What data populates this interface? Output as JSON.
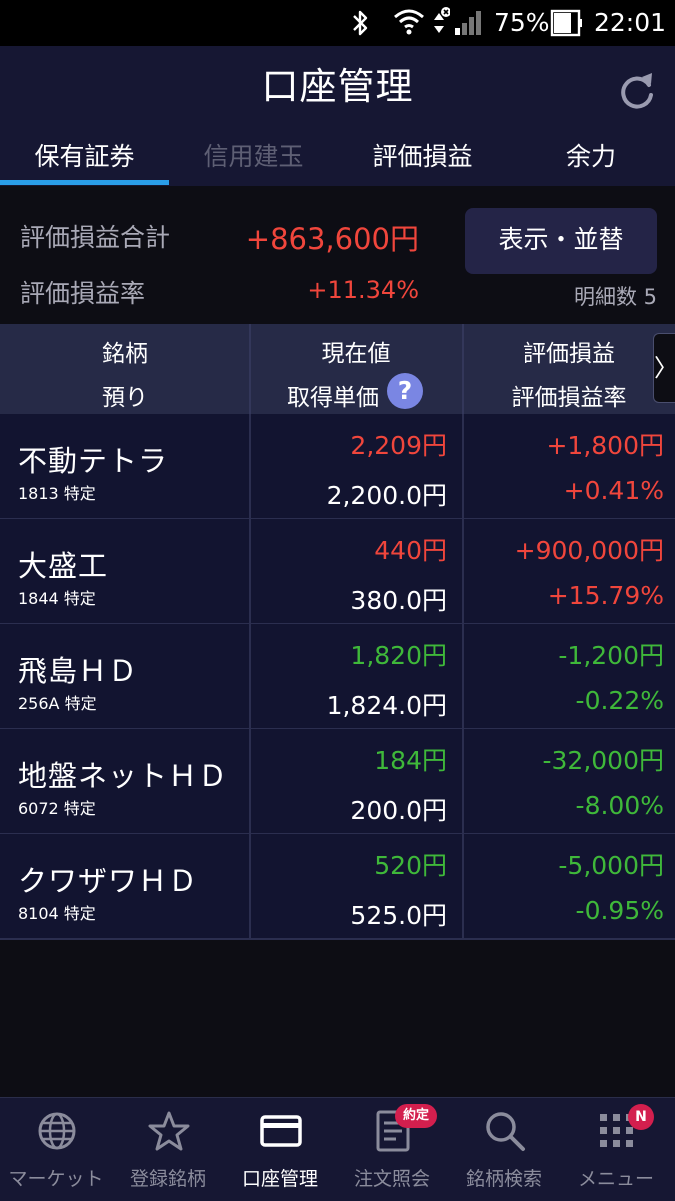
{
  "status_bar": {
    "battery": "75%",
    "time": "22:01"
  },
  "header": {
    "title": "口座管理"
  },
  "tabs": [
    {
      "label": "保有証券",
      "active": true,
      "enabled": true
    },
    {
      "label": "信用建玉",
      "active": false,
      "enabled": false
    },
    {
      "label": "評価損益",
      "active": false,
      "enabled": true
    },
    {
      "label": "余力",
      "active": false,
      "enabled": true
    }
  ],
  "summary": {
    "total_label": "評価損益合計",
    "total_value": "+863,600円",
    "rate_label": "評価損益率",
    "rate_value": "+11.34%",
    "sort_button": "表示・並替",
    "count_label": "明細数 5"
  },
  "table_header": {
    "col1_top": "銘柄",
    "col1_bottom": "預り",
    "col2_top": "現在値",
    "col2_bottom": "取得単価",
    "help": "?",
    "col3_top": "評価損益",
    "col3_bottom": "評価損益率",
    "more": "〉"
  },
  "rows": [
    {
      "name": "不動テトラ",
      "sub": "1813 特定",
      "price": "2,209円",
      "cost": "2,200.0円",
      "pl": "+1,800円",
      "plr": "+0.41%",
      "trend": "up"
    },
    {
      "name": "大盛工",
      "sub": "1844 特定",
      "price": "440円",
      "cost": "380.0円",
      "pl": "+900,000円",
      "plr": "+15.79%",
      "trend": "up"
    },
    {
      "name": "飛島ＨＤ",
      "sub": "256A 特定",
      "price": "1,820円",
      "cost": "1,824.0円",
      "pl": "-1,200円",
      "plr": "-0.22%",
      "trend": "down"
    },
    {
      "name": "地盤ネットＨＤ",
      "sub": "6072 特定",
      "price": "184円",
      "cost": "200.0円",
      "pl": "-32,000円",
      "plr": "-8.00%",
      "trend": "down"
    },
    {
      "name": "クワザワＨＤ",
      "sub": "8104 特定",
      "price": "520円",
      "cost": "525.0円",
      "pl": "-5,000円",
      "plr": "-0.95%",
      "trend": "down"
    }
  ],
  "bottom_nav": {
    "items": [
      {
        "label": "マーケット",
        "icon": "globe-icon",
        "active": false
      },
      {
        "label": "登録銘柄",
        "icon": "star-icon",
        "active": false
      },
      {
        "label": "口座管理",
        "icon": "card-icon",
        "active": true
      },
      {
        "label": "注文照会",
        "icon": "document-icon",
        "active": false
      },
      {
        "label": "銘柄検索",
        "icon": "search-icon",
        "active": false
      },
      {
        "label": "メニュー",
        "icon": "grid-menu-icon",
        "active": false
      }
    ],
    "order_badge": "約定",
    "menu_badge": "N"
  },
  "colors": {
    "profit": "#f0463c",
    "loss": "#3fb83a",
    "accent": "#2a9ee8",
    "header_bg": "#161733"
  }
}
